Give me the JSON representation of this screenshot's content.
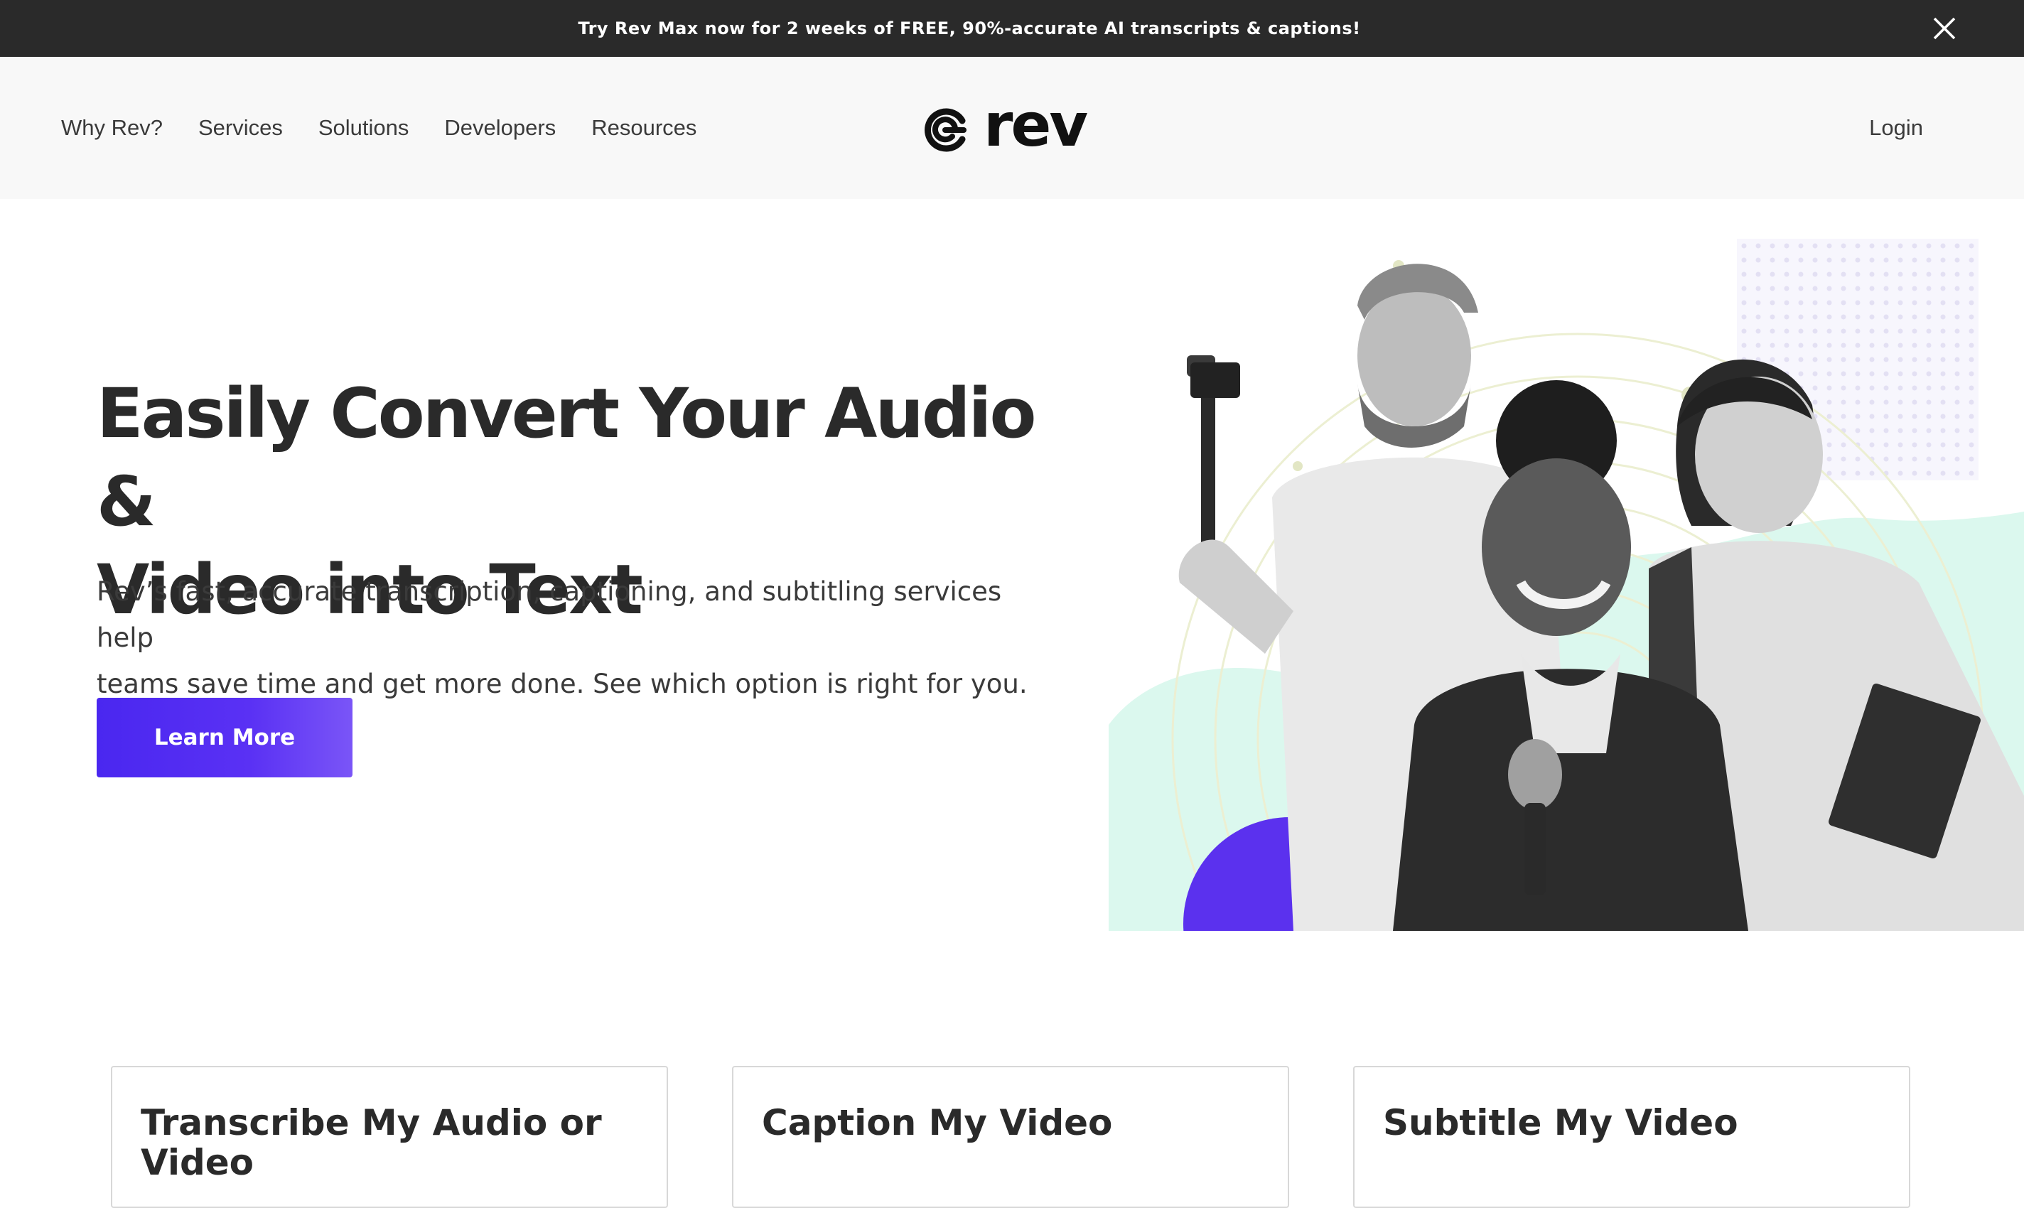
{
  "promo": {
    "text": "Try Rev Max now for 2 weeks of FREE, 90%-accurate AI transcripts & captions!",
    "close_icon": "close-icon"
  },
  "nav": {
    "links": [
      "Why Rev?",
      "Services",
      "Solutions",
      "Developers",
      "Resources"
    ],
    "logo_text": "rev",
    "logo_icon": "rev-logo-icon",
    "login": "Login"
  },
  "hero": {
    "title_line1": "Easily Convert Your Audio &",
    "title_line2": "Video into Text",
    "subtitle_line1": "Rev’s fast, accurate transcription, captioning, and subtitling services help",
    "subtitle_line2": "teams save time and get more done. See which option is right for you.",
    "cta": "Learn More"
  },
  "cards": [
    {
      "title": "Transcribe My Audio or Video"
    },
    {
      "title": "Caption My Video"
    },
    {
      "title": "Subtitle My Video"
    }
  ],
  "colors": {
    "banner": "#2a2a2a",
    "nav_bg": "#f8f8f8",
    "accent": "#4a27f0",
    "mint": "#d9f7ee"
  }
}
